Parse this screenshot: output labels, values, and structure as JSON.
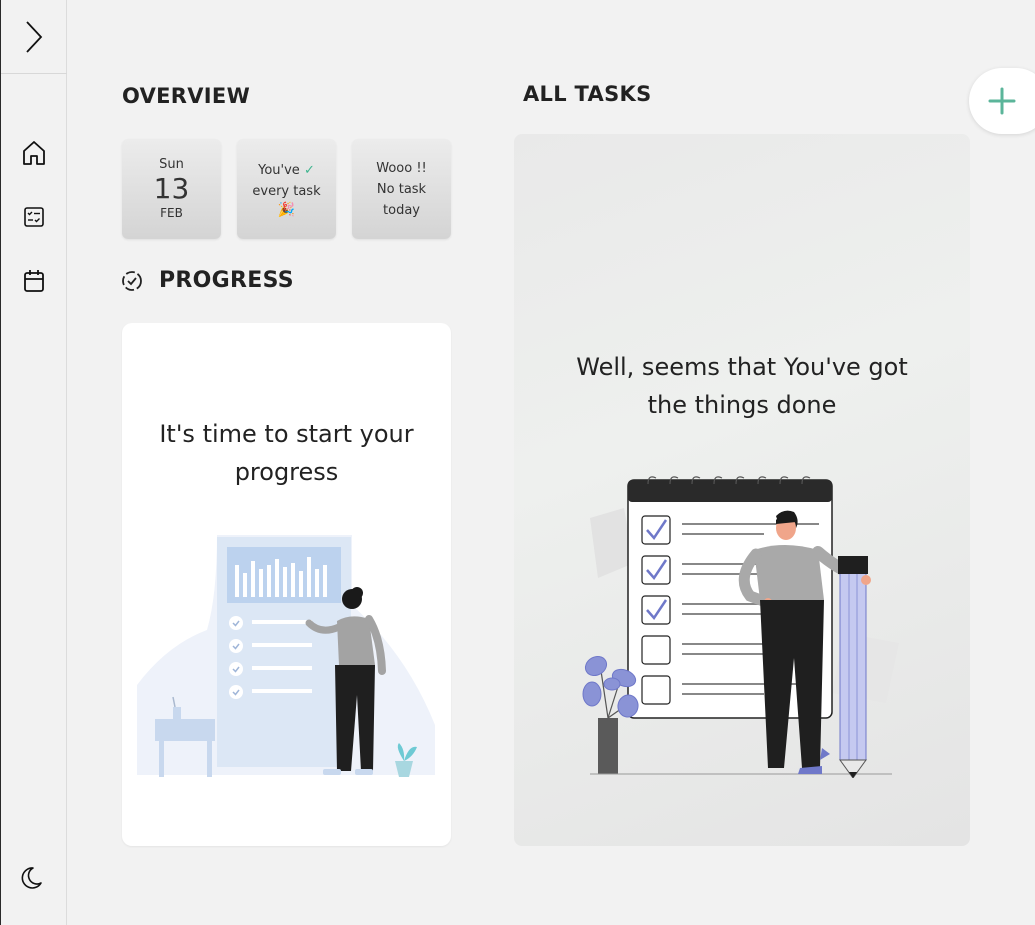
{
  "sidebar": {
    "toggle_icon": "chevron-right-icon",
    "items": [
      {
        "name": "home",
        "icon": "home-icon"
      },
      {
        "name": "tasks",
        "icon": "checklist-icon"
      },
      {
        "name": "calendar",
        "icon": "calendar-icon"
      }
    ],
    "theme_icon": "moon-icon"
  },
  "overview": {
    "title": "OVERVIEW",
    "date": {
      "day": "Sun",
      "number": "13",
      "month": "FEB"
    },
    "done_card": {
      "line1": "You've",
      "check": "✓",
      "line2": "every task",
      "emoji": "🎉"
    },
    "none_card": {
      "line1": "Wooo !!",
      "line2": "No task",
      "line3": "today"
    }
  },
  "progress": {
    "title": "PROGRESS",
    "message": "It's time to start your progress"
  },
  "all_tasks": {
    "title": "ALL TASKS",
    "message": "Well, seems that You've got the things done"
  },
  "add_button": {
    "label": "+",
    "color": "#5bb59a"
  },
  "colors": {
    "accent_green": "#3fb58f",
    "illustration_purple": "#6f78c9",
    "illustration_blue": "#c8d8ee"
  }
}
